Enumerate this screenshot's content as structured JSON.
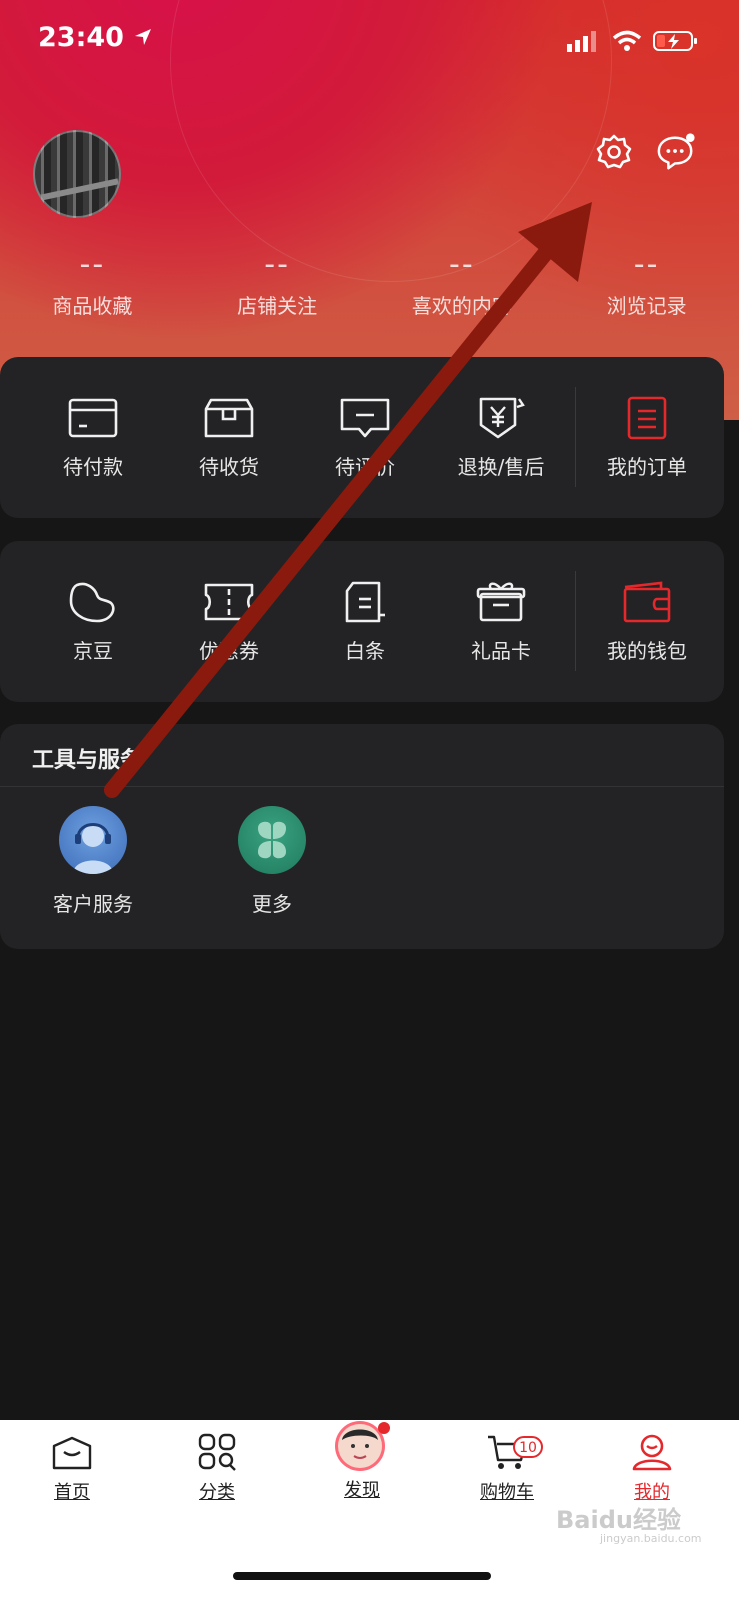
{
  "status": {
    "time": "23:40"
  },
  "stats": [
    {
      "value": "--",
      "label": "商品收藏"
    },
    {
      "value": "--",
      "label": "店铺关注"
    },
    {
      "value": "--",
      "label": "喜欢的内容"
    },
    {
      "value": "--",
      "label": "浏览记录"
    }
  ],
  "orders": {
    "items": [
      {
        "label": "待付款",
        "icon": "card-icon"
      },
      {
        "label": "待收货",
        "icon": "box-icon"
      },
      {
        "label": "待评价",
        "icon": "comment-icon"
      },
      {
        "label": "退换/售后",
        "icon": "refund-icon"
      }
    ],
    "main_label": "我的订单"
  },
  "wallet": {
    "items": [
      {
        "label": "京豆",
        "icon": "bean-icon"
      },
      {
        "label": "优惠券",
        "icon": "coupon-icon"
      },
      {
        "label": "白条",
        "icon": "receipt-icon"
      },
      {
        "label": "礼品卡",
        "icon": "gift-icon"
      }
    ],
    "main_label": "我的钱包"
  },
  "tools": {
    "title": "工具与服务",
    "items": [
      {
        "label": "客户服务",
        "icon": "customer-service-icon"
      },
      {
        "label": "更多",
        "icon": "more-clover-icon"
      }
    ]
  },
  "tabbar": {
    "items": [
      {
        "label": "首页"
      },
      {
        "label": "分类"
      },
      {
        "label": "发现"
      },
      {
        "label": "购物车"
      },
      {
        "label": "我的"
      }
    ],
    "cart_badge": "10",
    "active": "我的"
  },
  "watermark": {
    "main": "Baidu经验",
    "sub": "jingyan.baidu.com"
  },
  "colors": {
    "accent": "#e4282c",
    "background": "#161616",
    "card": "#232325",
    "annotation_arrow": "#8b1a0e"
  }
}
